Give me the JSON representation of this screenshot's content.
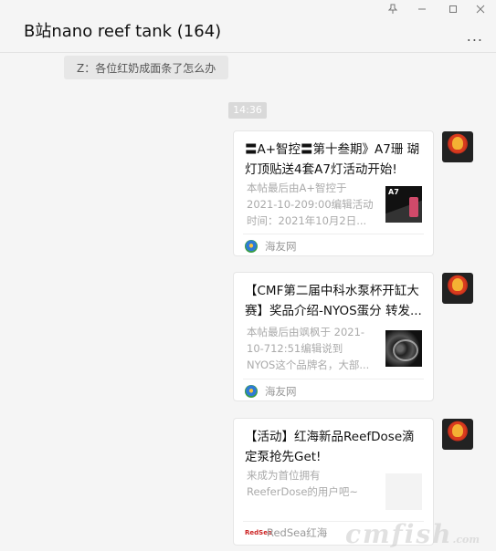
{
  "window": {
    "title": "B站nano reef tank (164)",
    "pin_icon": "pin-icon",
    "minimize_icon": "minimize-icon",
    "maximize_icon": "maximize-icon",
    "close_icon": "close-icon",
    "more_label": "..."
  },
  "chat": {
    "system_message": "Z：各位红奶成面条了怎么办",
    "timestamp": "14:36",
    "cards": [
      {
        "title": "〓A+智控〓第十叁期》A7珊 瑚灯顶贴送4套A7灯活动开始!",
        "description": "本帖最后由A+智控于 2021-10-209:00编辑活动 时间：2021年10月2日...",
        "source": "海友网",
        "thumbnail": "a7-lamp-thumbnail"
      },
      {
        "title": "【CMF第二届中科水泵杯开缸大 赛】奖品介绍-NYOS蛋分 转发...",
        "description": "本帖最后由飒枫于 2021-10-712:51编辑说到 NYOS这个品牌名，大部...",
        "source": "海友网",
        "thumbnail": "nyos-skimmer-thumbnail"
      },
      {
        "title": "【活动】红海新品ReefDose滴 定泵抢先Get!",
        "description": "来成为首位拥有 ReeferDose的用户吧~",
        "source": "RedSea红海",
        "source_logo": "RedSea",
        "thumbnail": "blank-thumbnail"
      }
    ]
  },
  "watermark": {
    "text": "cmfish",
    "suffix": ".com"
  }
}
